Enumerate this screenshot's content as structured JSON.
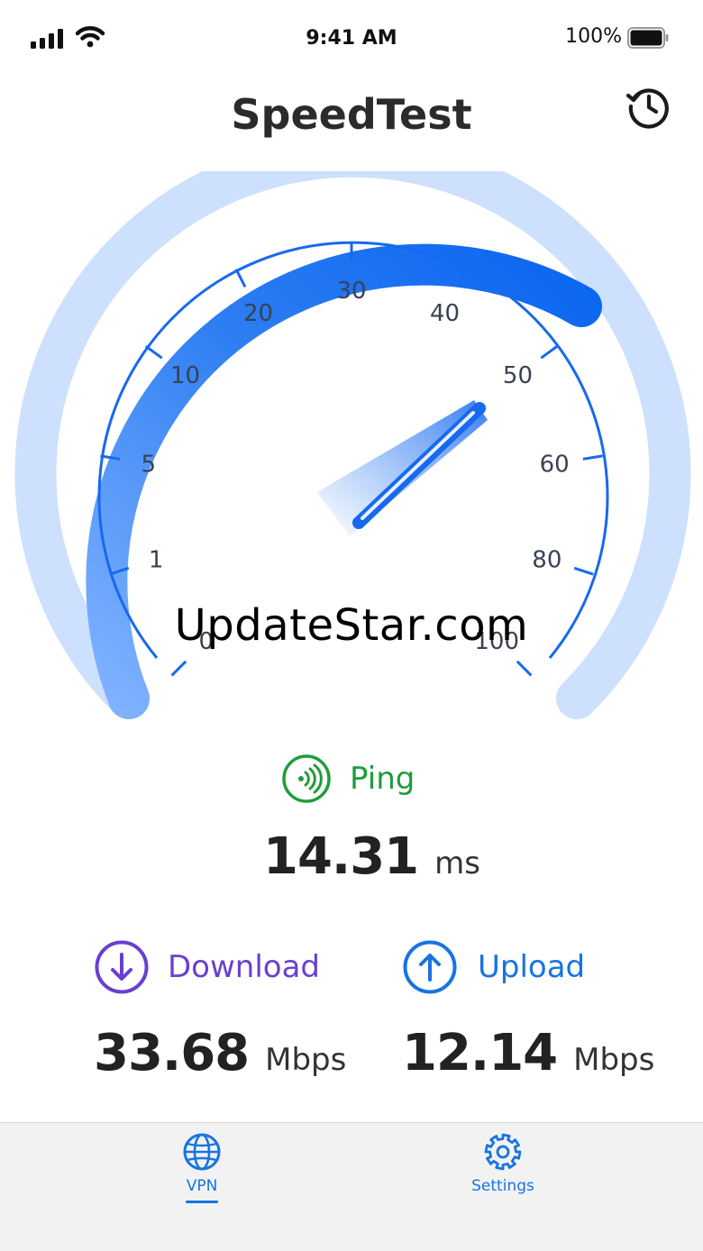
{
  "status_bar": {
    "time": "9:41 AM",
    "battery": "100%"
  },
  "header": {
    "title": "SpeedTest",
    "history_icon": "history-icon"
  },
  "gauge": {
    "scale_labels": [
      "0",
      "1",
      "5",
      "10",
      "20",
      "30",
      "40",
      "50",
      "60",
      "80",
      "100"
    ],
    "needle_value": 50
  },
  "watermark": "UpdateStar.com",
  "ping": {
    "label": "Ping",
    "value": "14.31",
    "unit": "ms",
    "color": "#1f9d3b"
  },
  "download": {
    "label": "Download",
    "value": "33.68",
    "unit": "Mbps",
    "color": "#6a3fd0"
  },
  "upload": {
    "label": "Upload",
    "value": "12.14",
    "unit": "Mbps",
    "color": "#1874e0"
  },
  "tab_bar": {
    "tabs": [
      {
        "label": "VPN",
        "icon": "globe-icon",
        "active": true
      },
      {
        "label": "Settings",
        "icon": "gear-icon",
        "active": false
      }
    ]
  }
}
